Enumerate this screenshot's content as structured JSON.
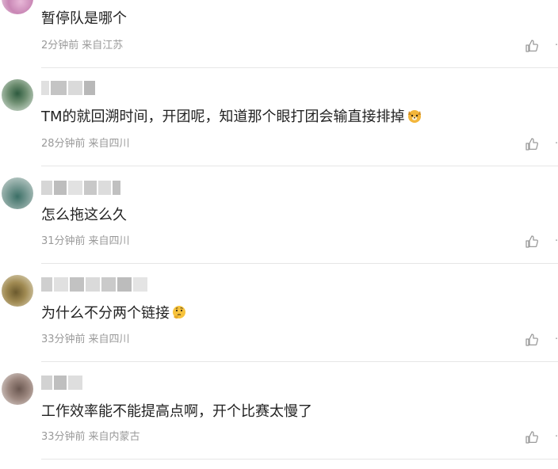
{
  "comments": [
    {
      "text": "暂停队是哪个",
      "time": "2分钟前",
      "location": "来自江苏",
      "has_emoji": false
    },
    {
      "text": "TM的就回溯时间，开团呢，知道那个眼打团会输直接排掉",
      "time": "28分钟前",
      "location": "来自四川",
      "has_emoji": true,
      "emoji": "dog-face-emoji"
    },
    {
      "text": "怎么拖这么久",
      "time": "31分钟前",
      "location": "来自四川",
      "has_emoji": false
    },
    {
      "text": "为什么不分两个链接",
      "time": "33分钟前",
      "location": "来自四川",
      "has_emoji": true,
      "emoji": "thinking-face-emoji"
    },
    {
      "text": "工作效率能不能提高点啊，开个比赛太慢了",
      "time": "33分钟前",
      "location": "来自内蒙古",
      "has_emoji": false
    }
  ],
  "icons": {
    "like": "thumbs-up-icon"
  },
  "colors": {
    "text": "#222222",
    "meta": "#9a9a9a",
    "divider": "#e6e6e6"
  }
}
